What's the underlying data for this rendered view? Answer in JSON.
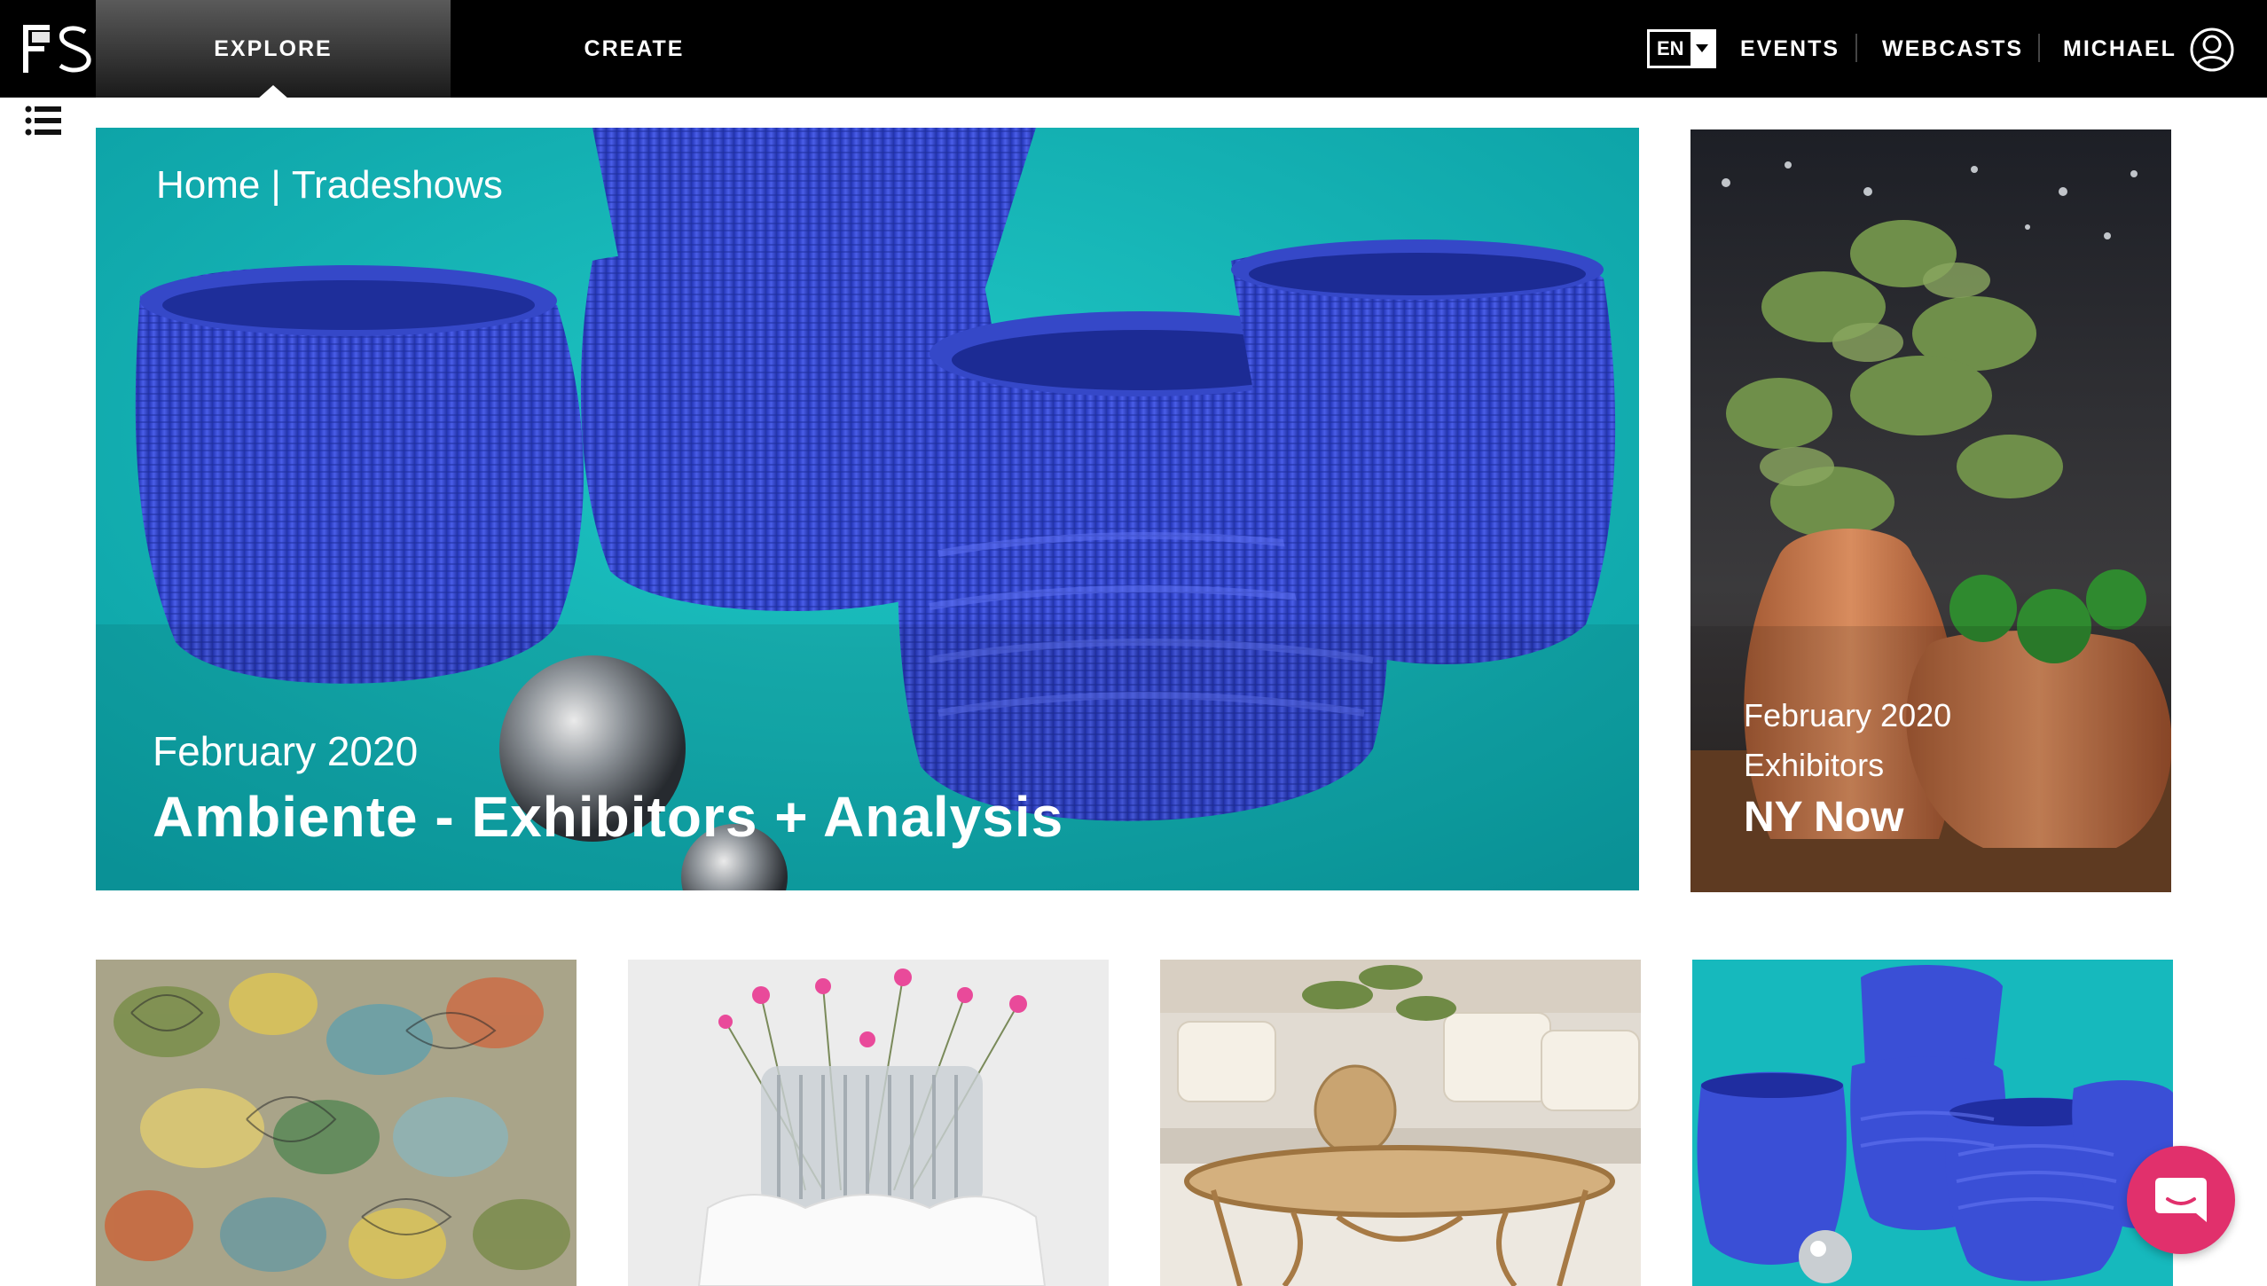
{
  "header": {
    "logo": "FS",
    "nav": [
      {
        "label": "EXPLORE",
        "active": true
      },
      {
        "label": "CREATE",
        "active": false
      }
    ],
    "language": "EN",
    "links": [
      "EVENTS",
      "WEBCASTS",
      "MICHAEL"
    ],
    "user_icon": "user-circle-icon",
    "menu_icon": "list-menu-icon"
  },
  "hero": {
    "breadcrumb": [
      "Home",
      "|",
      "Tradeshows"
    ],
    "date": "February 2020",
    "title": "Ambiente - Exhibitors + Analysis"
  },
  "side_feature": {
    "date": "February 2020",
    "category": "Exhibitors",
    "title": "NY Now"
  },
  "thumbnails": [
    {
      "name": "butterfly-fabric"
    },
    {
      "name": "glass-vase-flowers"
    },
    {
      "name": "rattan-coffee-table"
    },
    {
      "name": "blue-3d-printed-vases"
    }
  ],
  "chat": {
    "icon": "chat-icon",
    "color": "#e1306c"
  },
  "colors": {
    "topbar": "#000000",
    "hero_bg": "#12b4b4",
    "vase_blue": "#3a4fd6"
  }
}
